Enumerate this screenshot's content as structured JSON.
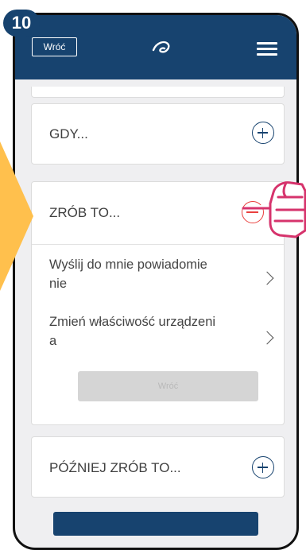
{
  "step": {
    "number": "10"
  },
  "header": {
    "back_label": "Wróć",
    "logo_icon": "app-logo-icon",
    "menu_icon": "hamburger-menu-icon"
  },
  "sections": {
    "if": {
      "label": "GDY...",
      "button_icon": "plus-circle-icon"
    },
    "then": {
      "label": "ZRÓB TO...",
      "button_icon": "minus-circle-icon",
      "options": [
        {
          "line1": "Wyślij do mnie powiadomie",
          "line2": "nie"
        },
        {
          "line1": "Zmień właściwość urządzeni",
          "line2": "a"
        }
      ],
      "back_label": "Wróć"
    },
    "later": {
      "label": "PÓŹNIEJ ZRÓB TO...",
      "button_icon": "plus-circle-icon"
    }
  },
  "colors": {
    "header": "#17436f",
    "accent_minus": "#e9403e",
    "arrow": "#ffc04d",
    "hand": "#d6336c"
  }
}
